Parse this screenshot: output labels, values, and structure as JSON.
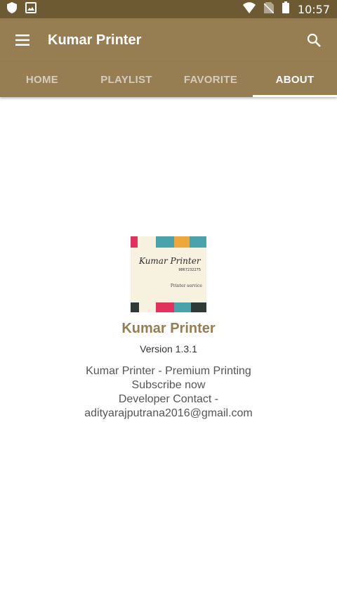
{
  "status_bar": {
    "time": "10:57",
    "left_icons": [
      "shield-icon",
      "image-icon"
    ],
    "right_icons": [
      "wifi-icon",
      "no-sim-icon",
      "battery-icon"
    ]
  },
  "app_bar": {
    "title": "Kumar Printer",
    "menu_icon": "menu-icon",
    "search_icon": "search-icon"
  },
  "tabs": [
    {
      "label": "HOME",
      "active": false
    },
    {
      "label": "PLAYLIST",
      "active": false
    },
    {
      "label": "FAVORITE",
      "active": false
    },
    {
      "label": "ABOUT",
      "active": true
    }
  ],
  "about": {
    "logo": {
      "name": "Kumar Printer",
      "phone": "9867232275",
      "service": "Printer service"
    },
    "title": "Kumar Printer",
    "version": "Version 1.3.1",
    "description_lines": [
      "Kumar Printer - Premium Printing",
      "Subscribe now",
      "Developer Contact -",
      "adityarajputrana2016@gmail.com"
    ]
  },
  "colors": {
    "primary": "#967d52",
    "primary_dark": "#6e5a32",
    "accent_text": "#967d52"
  }
}
